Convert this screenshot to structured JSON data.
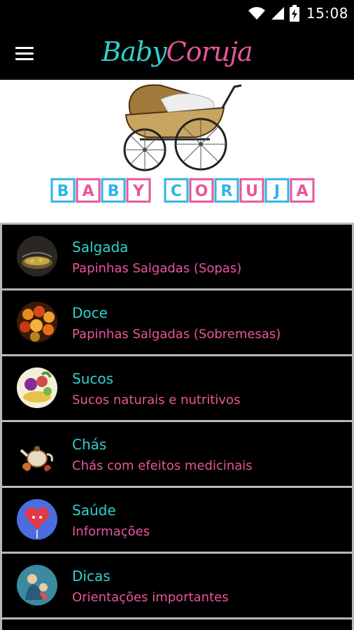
{
  "status_bar": {
    "time": "15:08",
    "icons": [
      "wifi-icon",
      "signal-icon",
      "battery-charging-icon"
    ]
  },
  "app_bar": {
    "menu_icon": "hamburger-menu-icon",
    "title_part1": "Baby",
    "title_part2": "Coruja",
    "title_colors": [
      "#2fd1cf",
      "#e9559a"
    ]
  },
  "banner": {
    "image": "baby-carriage-illustration",
    "blocks": [
      {
        "letter": "B",
        "color": "#2fb4e6"
      },
      {
        "letter": "A",
        "color": "#e9559a"
      },
      {
        "letter": "B",
        "color": "#2fb4e6"
      },
      {
        "letter": "Y",
        "color": "#e9559a"
      },
      {
        "letter": "C",
        "color": "#2fb4e6"
      },
      {
        "letter": "O",
        "color": "#e9559a"
      },
      {
        "letter": "R",
        "color": "#2fb4e6"
      },
      {
        "letter": "U",
        "color": "#e9559a"
      },
      {
        "letter": "J",
        "color": "#2fb4e6"
      },
      {
        "letter": "A",
        "color": "#e9559a"
      }
    ]
  },
  "menu": {
    "items": [
      {
        "title": "Salgada",
        "subtitle": "Papinhas Salgadas (Sopas)",
        "icon": "soup-pot-icon"
      },
      {
        "title": "Doce",
        "subtitle": "Papinhas Salgadas (Sobremesas)",
        "icon": "fruit-basket-icon"
      },
      {
        "title": "Sucos",
        "subtitle": "Sucos naturais e nutritivos",
        "icon": "fruits-icon"
      },
      {
        "title": "Chás",
        "subtitle": "Chás com efeitos medicinais",
        "icon": "teapot-icon"
      },
      {
        "title": "Saúde",
        "subtitle": "Informações",
        "icon": "heart-balloon-icon"
      },
      {
        "title": "Dicas",
        "subtitle": "Orientações importantes",
        "icon": "mother-baby-icon"
      }
    ]
  },
  "colors": {
    "accent_cyan": "#2fd1cf",
    "accent_pink": "#e9559a",
    "background": "#000000",
    "divider": "#b9b9b9"
  }
}
